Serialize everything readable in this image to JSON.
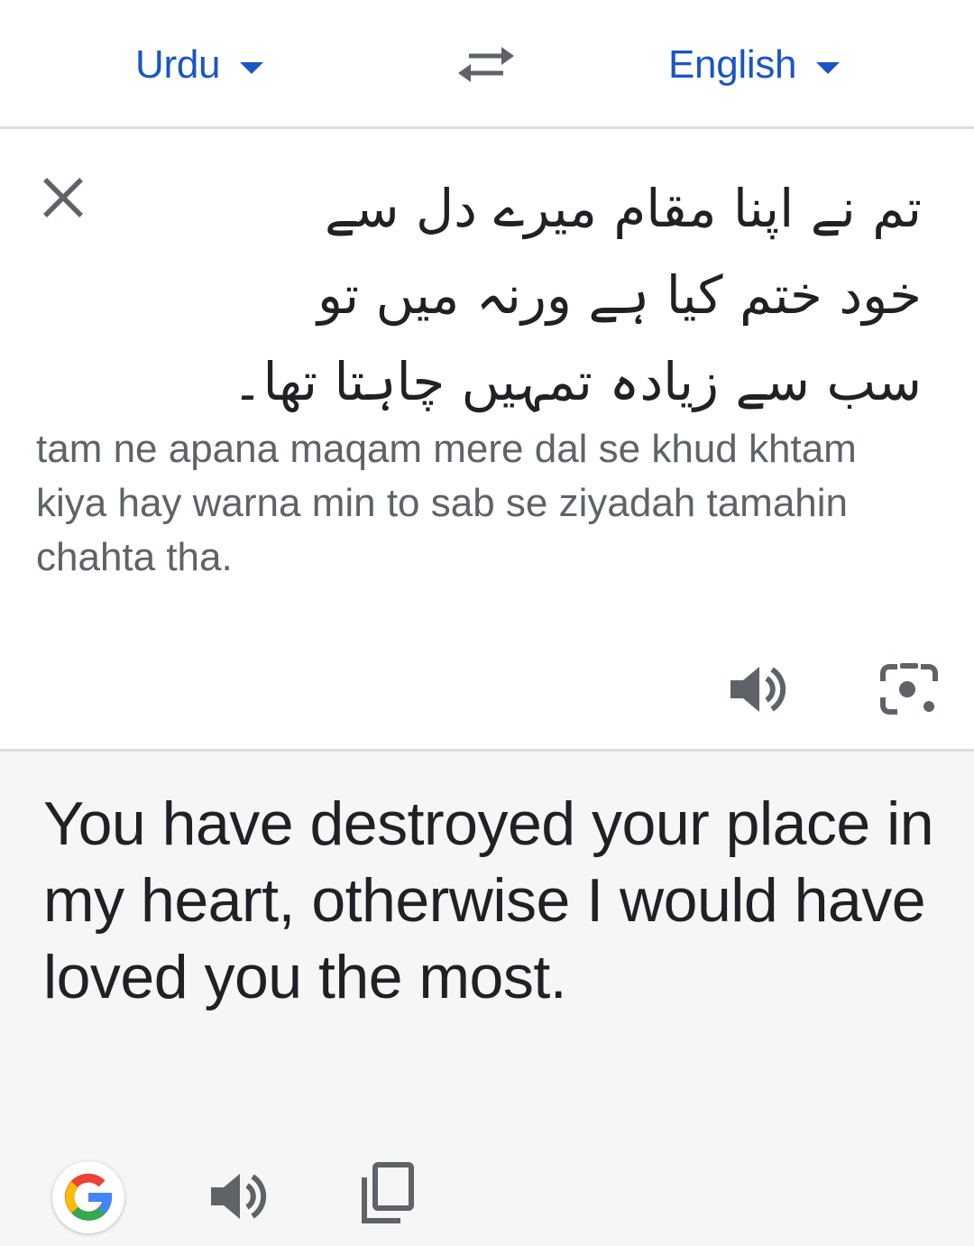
{
  "lang_bar": {
    "source_language": "Urdu",
    "target_language": "English",
    "accent_color": "#1a56c2",
    "icons": {
      "swap": "swap-arrows-icon",
      "dropdown": "caret-down-icon"
    }
  },
  "source": {
    "lines": [
      "تم نے اپنا مقام میرے دل سے",
      "خود ختم کیا ہے ورنہ میں تو",
      "سب سے زیادہ تمہیں چاہتا تھا۔"
    ],
    "transliteration": "tam ne apana maqam mere dal se khud khtam kiya hay warna min to sab se ziyadah tamahin chahta tha.",
    "icons": {
      "clear": "close-icon",
      "listen": "speaker-icon",
      "camera": "camera-icon"
    }
  },
  "result": {
    "text": "You have destroyed your place in my heart, otherwise I would have loved you the most.",
    "icons": {
      "logo": "google-logo-icon",
      "listen": "speaker-icon",
      "copy": "copy-icon"
    }
  }
}
